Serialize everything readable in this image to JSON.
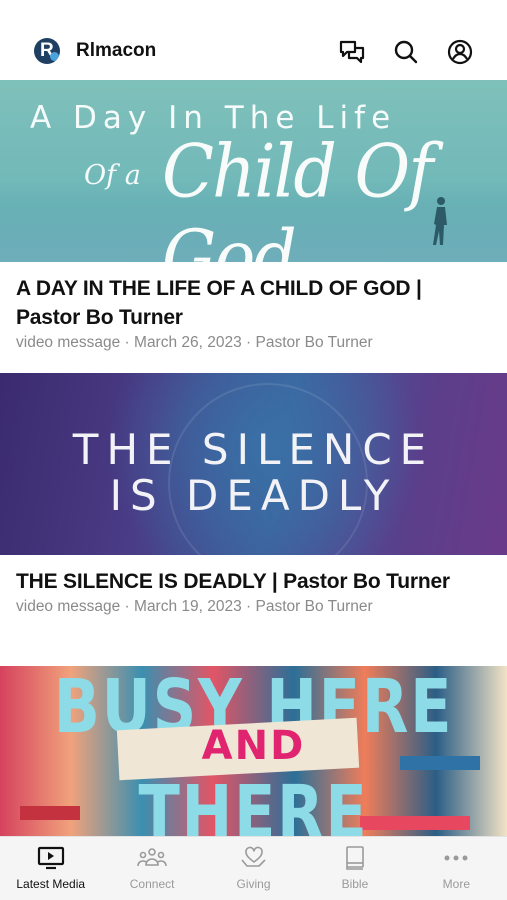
{
  "header": {
    "app_name": "Rlmacon",
    "logo_letter": "R",
    "icons": [
      "chat-icon",
      "search-icon",
      "profile-icon"
    ]
  },
  "feed": [
    {
      "thumb_text": [
        "A Day In The Life",
        "Of a",
        "Child Of God"
      ],
      "title": "A DAY IN THE LIFE OF A CHILD OF GOD | Pastor Bo Turner",
      "subtitle": "video message · March 26, 2023 · Pastor Bo Turner"
    },
    {
      "thumb_text": [
        "THE SILENCE",
        "IS DEADLY"
      ],
      "title": "THE SILENCE IS DEADLY | Pastor Bo Turner",
      "subtitle": "video message · March 19, 2023 · Pastor Bo Turner"
    },
    {
      "thumb_text": [
        "BUSY HERE",
        "AND",
        "THERE"
      ]
    }
  ],
  "tabbar": {
    "tabs": [
      {
        "label": "Latest Media",
        "icon": "tv-icon",
        "active": true
      },
      {
        "label": "Connect",
        "icon": "people-icon",
        "active": false
      },
      {
        "label": "Giving",
        "icon": "heart-hand-icon",
        "active": false
      },
      {
        "label": "Bible",
        "icon": "book-icon",
        "active": false
      },
      {
        "label": "More",
        "icon": "more-icon",
        "active": false
      }
    ]
  },
  "colors": {
    "text_primary": "#111111",
    "text_secondary": "#8a8a8a",
    "tab_inactive": "#9a9a9a",
    "logo_navy": "#1f3f63",
    "logo_blue": "#4aa3df"
  }
}
